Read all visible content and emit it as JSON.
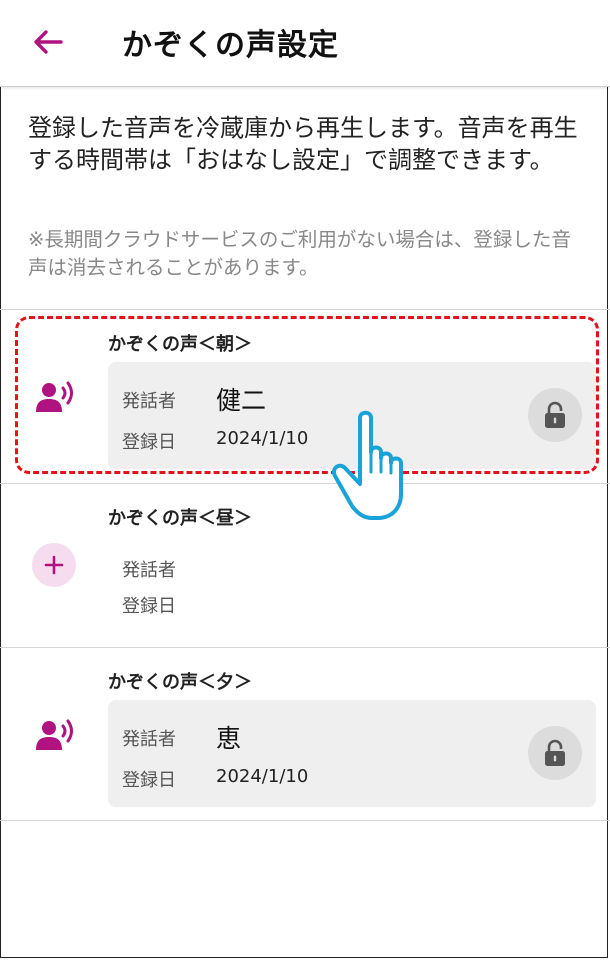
{
  "header": {
    "title": "かぞくの声設定",
    "back_icon": "arrow-left-icon"
  },
  "intro": {
    "text": "登録した音声を冷蔵庫から再生します。音声を再生する時間帯は「おはなし設定」で調整できます。",
    "note": "※長期間クラウドサービスのご利用がない場合は、登録した音声は消去されることがあります。"
  },
  "labels": {
    "speaker": "発話者",
    "registered_date": "登録日"
  },
  "slots": [
    {
      "title": "かぞくの声＜朝＞",
      "speaker": "健二",
      "date": "2024/1/10",
      "icon": "voice-speaking-icon",
      "lock_icon": "lock-icon",
      "registered": true
    },
    {
      "title": "かぞくの声＜昼＞",
      "speaker": "",
      "date": "",
      "icon": "plus-icon",
      "registered": false
    },
    {
      "title": "かぞくの声＜夕＞",
      "speaker": "恵",
      "date": "2024/1/10",
      "icon": "voice-speaking-icon",
      "lock_icon": "lock-icon",
      "registered": true
    }
  ],
  "colors": {
    "accent": "#b0137f",
    "highlight": "#e0151b",
    "pointer": "#1aa3d9",
    "box": "#efefef",
    "lock_bg": "#dcdcdc",
    "add_bg": "#f6dcef"
  }
}
